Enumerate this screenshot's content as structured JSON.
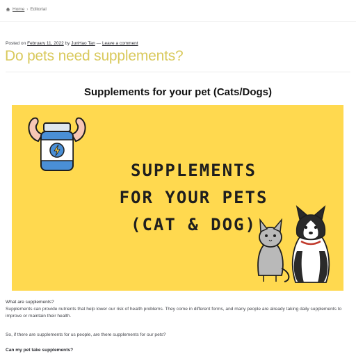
{
  "breadcrumb": {
    "home_label": "Home",
    "separator": "›",
    "current": "Editorial"
  },
  "meta": {
    "posted_on": "Posted on",
    "date": "February 11, 2022",
    "by": "by",
    "author": "JunHao Tan",
    "dash": "—",
    "comment_link": "Leave a comment"
  },
  "post": {
    "title": "Do pets need supplements?",
    "section_heading": "Supplements for your pet (Cats/Dogs)"
  },
  "hero": {
    "line1": "SUPPLEMENTS",
    "line2": "FOR YOUR PETS",
    "line3": "(CAT & DOG)",
    "background_color": "#ffd94f"
  },
  "content": {
    "q1": "What are supplements?",
    "p1": "Supplements can provide nutrients that help lower our risk of health problems. They come in different forms, and many people are already taking daily supplements to improve or maintain their health.",
    "p2": "So, if there are supplements for us people, are there supplements for our pets?",
    "q2": "Can my pet take supplements?"
  },
  "colors": {
    "title": "#d9c95c",
    "hero_bg": "#ffd94f"
  }
}
